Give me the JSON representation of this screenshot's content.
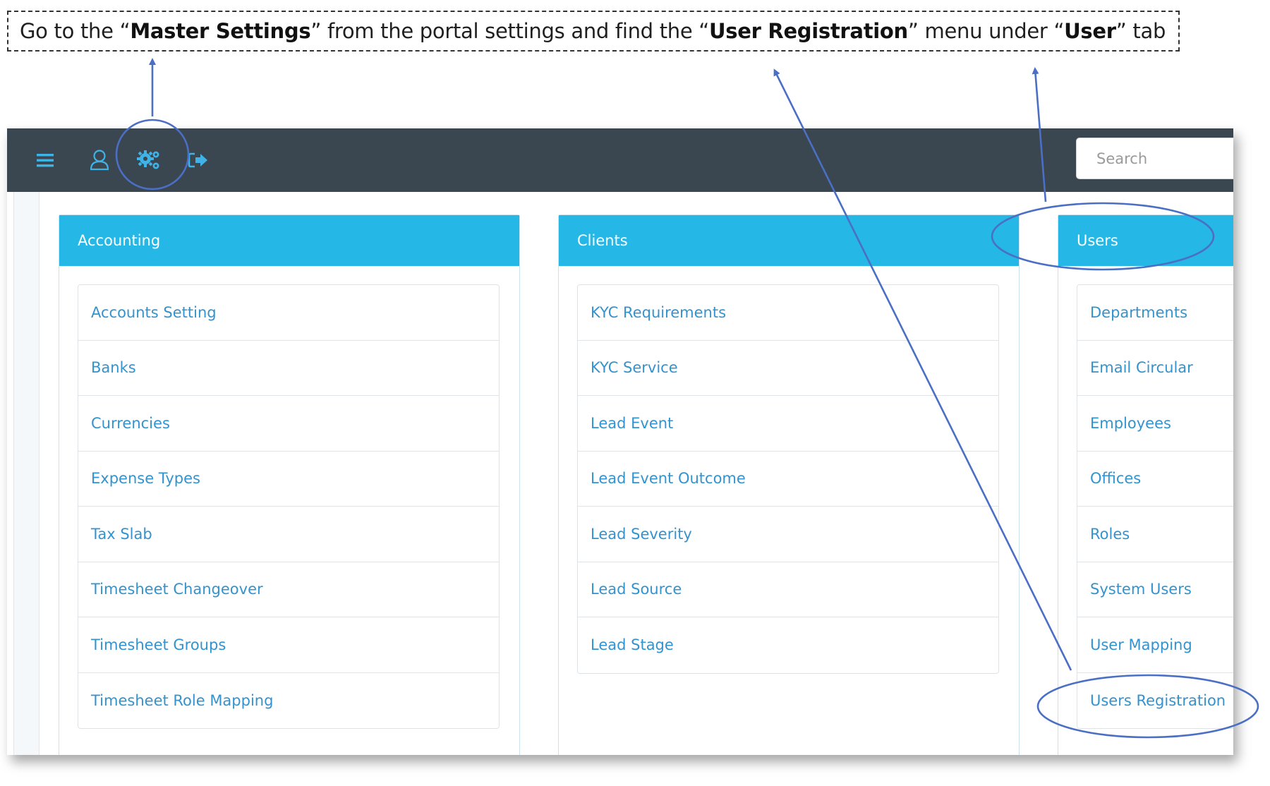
{
  "instruction": {
    "part1": "Go to the “",
    "bold1": "Master Settings",
    "part2": "” from the portal settings and find the “",
    "bold2": "User Registration",
    "part3": "” menu under “",
    "bold3": "User",
    "part4": "” tab"
  },
  "toolbar": {
    "icons": [
      "hamburger-menu-icon",
      "user-profile-icon",
      "gears-settings-icon",
      "sign-out-icon"
    ],
    "icon_color": "#3fb3e8"
  },
  "search": {
    "placeholder": "Search"
  },
  "panels": {
    "accounting": {
      "title": "Accounting",
      "items": [
        "Accounts Setting",
        "Banks",
        "Currencies",
        "Expense Types",
        "Tax Slab",
        "Timesheet Changeover",
        "Timesheet Groups",
        "Timesheet Role Mapping"
      ]
    },
    "clients": {
      "title": "Clients",
      "items": [
        "KYC Requirements",
        "KYC Service",
        "Lead Event",
        "Lead Event Outcome",
        "Lead Severity",
        "Lead Source",
        "Lead Stage"
      ]
    },
    "users": {
      "title": "Users",
      "items": [
        "Departments",
        "Email Circular",
        "Employees",
        "Offices",
        "Roles",
        "System Users",
        "User Mapping",
        "Users Registration"
      ]
    }
  },
  "colors": {
    "topbar": "#3a4650",
    "panel_header": "#25b7e6",
    "link_text": "#3393ce",
    "annotation": "#4a6fc4"
  }
}
